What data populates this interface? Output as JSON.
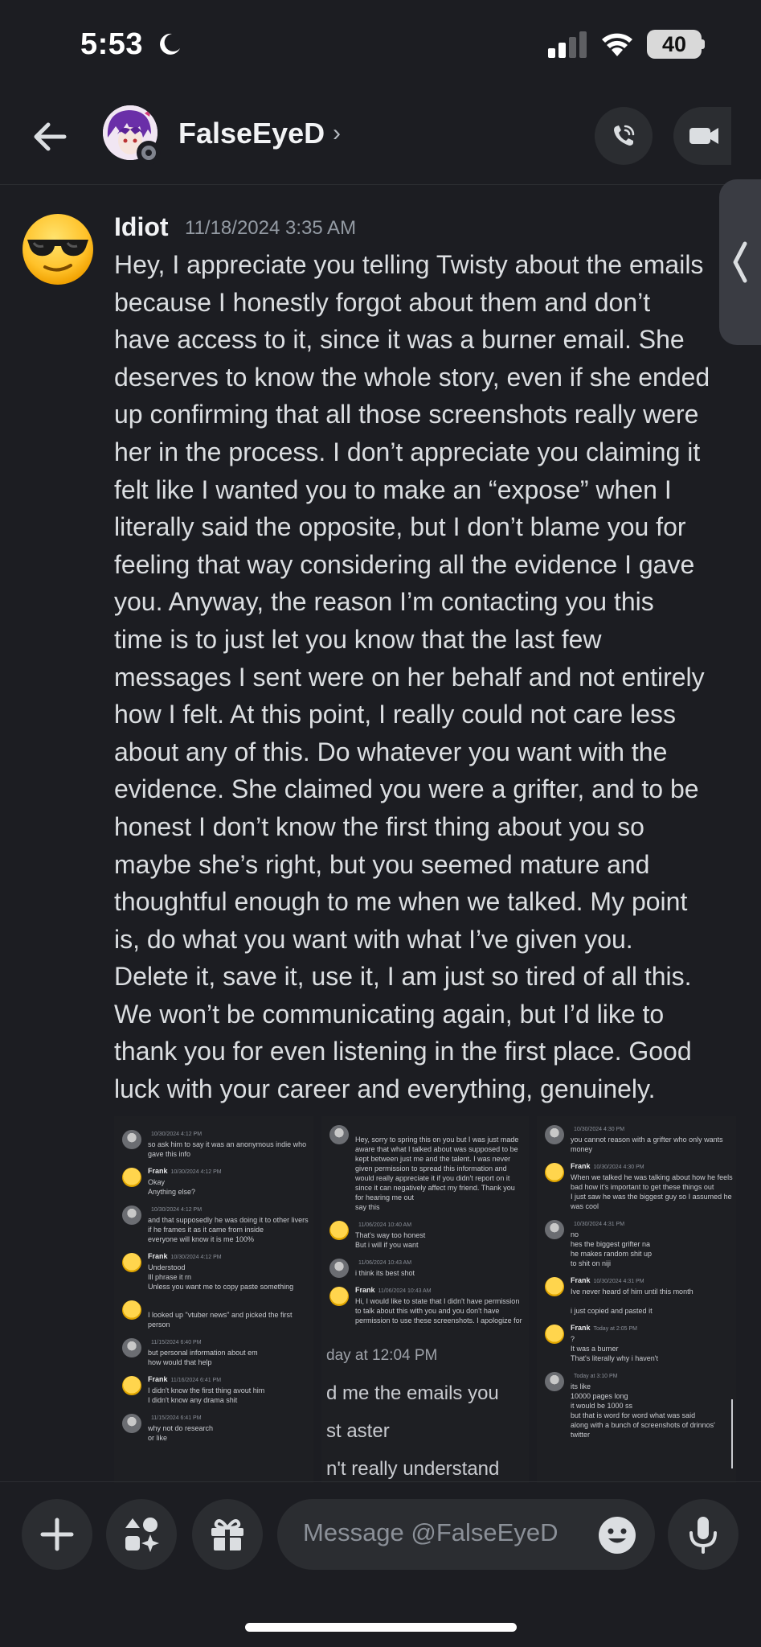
{
  "status_bar": {
    "time": "5:53",
    "battery": "40"
  },
  "header": {
    "contact_name": "FalseEyeD",
    "chevron": "›"
  },
  "message": {
    "author": "Idiot",
    "timestamp": "11/18/2024 3:35 AM",
    "lines": [
      "Hey, I appreciate you telling Twisty about the emails",
      "because I honestly forgot about them and don’t",
      "have access to it, since it was a burner email. She",
      "deserves to know the whole story, even if she ended",
      "up confirming that all those screenshots really were",
      "her in the process. I don’t appreciate you claiming it",
      "felt like I wanted you to make an “expose” when I",
      "literally said the opposite, but I don’t blame you for",
      "feeling that way considering all the evidence I gave",
      "you. Anyway, the reason I’m contacting you this",
      "time is to just let you know that the last few",
      "messages I sent were on her behalf and not entirely",
      "how I felt. At this point, I really could not care less",
      "about any of this. Do whatever you want with the",
      "evidence. She claimed you were a grifter, and to be",
      "honest I don’t know the first thing about you so",
      "maybe she’s right, but you seemed mature and",
      "thoughtful enough to me when we talked. My point",
      "is, do what you want with what I’ve given you.",
      "Delete it, save it, use it, I am just so tired of all this.",
      "We won’t be communicating again, but I’d like to",
      "thank you for even listening in the first place. Good",
      "luck with your career and everything, genuinely."
    ]
  },
  "attachments": [
    {
      "messages": [
        {
          "avatar": "gray",
          "name": "",
          "date": "10/30/2024 4:12 PM",
          "lines": [
            "so ask him to say it was an anonymous indie who",
            "gave this info"
          ]
        },
        {
          "avatar": "yellow",
          "name": "Frank",
          "date": "10/30/2024 4:12 PM",
          "lines": [
            "Okay",
            "Anything else?"
          ]
        },
        {
          "avatar": "gray",
          "name": "",
          "date": "10/30/2024 4:12 PM",
          "lines": [
            "and that supposedly he was doing it to other livers",
            "if he frames it as it came from inside",
            "everyone will know it is me 100%"
          ]
        },
        {
          "avatar": "yellow",
          "name": "Frank",
          "date": "10/30/2024 4:12 PM",
          "lines": [
            "Understood",
            "Ill phrase it rn",
            "Unless you want me to copy paste something"
          ]
        },
        {
          "avatar": "yellow",
          "name": "",
          "date": "",
          "lines": [
            "I looked up \"vtuber news\" and picked the first",
            "person"
          ]
        },
        {
          "avatar": "gray",
          "name": "",
          "date": "11/15/2024 6:40 PM",
          "lines": [
            "but personal information about em",
            "how would that help"
          ]
        },
        {
          "avatar": "yellow",
          "name": "Frank",
          "date": "11/16/2024 6:41 PM",
          "lines": [
            "I didn't know the first thing avout him",
            "I didn't know any drama shit"
          ]
        },
        {
          "avatar": "gray",
          "name": "",
          "date": "11/15/2024 6:41 PM",
          "lines": [
            "why not do research",
            "or like"
          ]
        }
      ]
    },
    {
      "messages": [
        {
          "avatar": "gray",
          "name": "",
          "date": "",
          "lines": [
            "Hey, sorry to spring this on you but I was just made",
            "aware that what I talked about was supposed to be",
            "kept between just me and the talent. I was never",
            "given permission to spread this information and",
            "would really appreciate it if you didn't report on it",
            "since it can negatively affect my friend. Thank you",
            "for hearing me out",
            "say this"
          ]
        },
        {
          "avatar": "yellow",
          "name": "",
          "date": "11/06/2024 10:40 AM",
          "lines": [
            "That's way too honest",
            "But i will if you want"
          ]
        },
        {
          "avatar": "gray",
          "name": "",
          "date": "11/06/2024 10:43 AM",
          "lines": [
            "i think its best shot"
          ]
        },
        {
          "avatar": "yellow",
          "name": "Frank",
          "date": "11/06/2024 10:43 AM",
          "lines": [
            "Hi, I would like to state that I didn't have permission",
            "to talk about this with you and you don't have",
            "permission to use these screenshots. I apologize for"
          ]
        }
      ],
      "big_lines": [
        "day at 12:04 PM",
        "d me the emails you",
        "st aster",
        "n't really understand"
      ]
    },
    {
      "messages": [
        {
          "avatar": "gray",
          "name": "",
          "date": "10/30/2024 4:30 PM",
          "lines": [
            "you cannot reason with a grifter who only wants",
            "money"
          ]
        },
        {
          "avatar": "yellow",
          "name": "Frank",
          "date": "10/30/2024 4:30 PM",
          "lines": [
            "When we talked he was talking about how he feels",
            "bad how it's important to get these things out",
            "I just saw he was the biggest guy so I assumed he",
            "was cool"
          ]
        },
        {
          "avatar": "gray",
          "name": "",
          "date": "10/30/2024 4:31 PM",
          "lines": [
            "no",
            "hes the biggest grifter na",
            "he makes random shit up",
            "to shit on niji"
          ]
        },
        {
          "avatar": "yellow",
          "name": "Frank",
          "date": "10/30/2024 4:31 PM",
          "lines": [
            "Ive never heard of him until this month",
            "",
            "i just copied and pasted it"
          ]
        },
        {
          "avatar": "yellow",
          "name": "Frank",
          "date": "Today at 2:05 PM",
          "lines": [
            "?",
            "It was a burner",
            "That's literally why i haven't"
          ]
        },
        {
          "avatar": "gray",
          "name": "",
          "date": "Today at 3:10 PM",
          "lines": [
            "its like",
            "10000 pages long",
            "it would be 1000 ss",
            "but that is word for word what was said",
            "along with a bunch of screenshots of drinnos'",
            "twitter"
          ]
        }
      ]
    }
  ],
  "composer": {
    "placeholder": "Message @FalseEyeD"
  }
}
